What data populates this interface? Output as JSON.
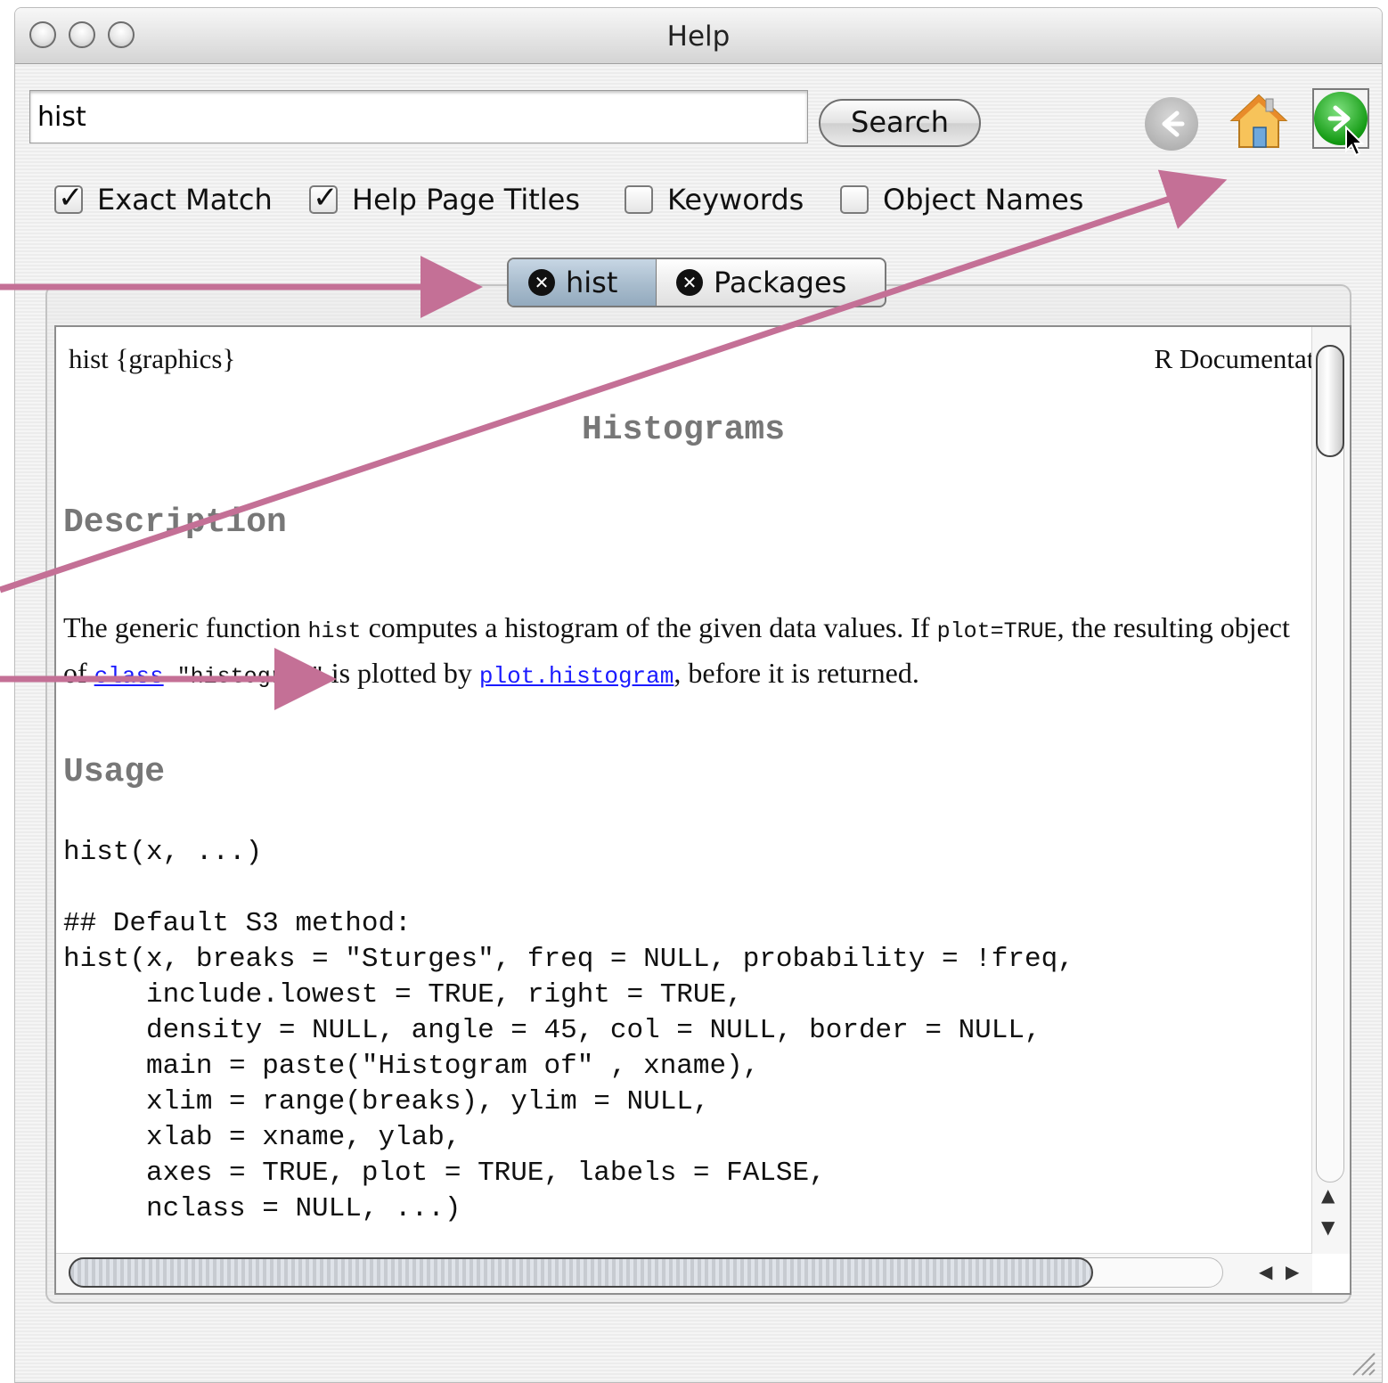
{
  "window": {
    "title": "Help"
  },
  "toolbar": {
    "search_value": "hist",
    "search_button": "Search",
    "back_icon": "back-arrow-icon",
    "home_icon": "home-icon",
    "forward_icon": "forward-arrow-icon"
  },
  "options": [
    {
      "label": "Exact Match",
      "checked": true
    },
    {
      "label": "Help Page Titles",
      "checked": true
    },
    {
      "label": "Keywords",
      "checked": false
    },
    {
      "label": "Object Names",
      "checked": false
    }
  ],
  "tabs": [
    {
      "label": "hist",
      "active": true
    },
    {
      "label": "Packages",
      "active": false
    }
  ],
  "doc": {
    "header_left": "hist {graphics}",
    "header_right": "R Documentation",
    "title": "Histograms",
    "description_heading": "Description",
    "desc_text_1": "The generic function ",
    "desc_code_1": "hist",
    "desc_text_2": " computes a histogram of the given data values. If ",
    "desc_code_2": "plot=TRUE",
    "desc_text_3": ", the resulting object of ",
    "desc_link_1": "class",
    "desc_code_3": " \"histogram\"",
    "desc_text_4": " is plotted by ",
    "desc_link_2": "plot.histogram",
    "desc_text_5": ", before it is returned.",
    "usage_heading": "Usage",
    "usage_line1": "hist(x, ...)",
    "usage_block": "## Default S3 method:\nhist(x, breaks = \"Sturges\", freq = NULL, probability = !freq,\n     include.lowest = TRUE, right = TRUE,\n     density = NULL, angle = 45, col = NULL, border = NULL,\n     main = paste(\"Histogram of\" , xname),\n     xlim = range(breaks), ylim = NULL,\n     xlab = xname, ylab,\n     axes = TRUE, plot = TRUE, labels = FALSE,\n     nclass = NULL, ...)"
  },
  "colors": {
    "annotation_arrow": "#c47096",
    "link": "#1a1aff",
    "heading_gray": "#777777"
  }
}
